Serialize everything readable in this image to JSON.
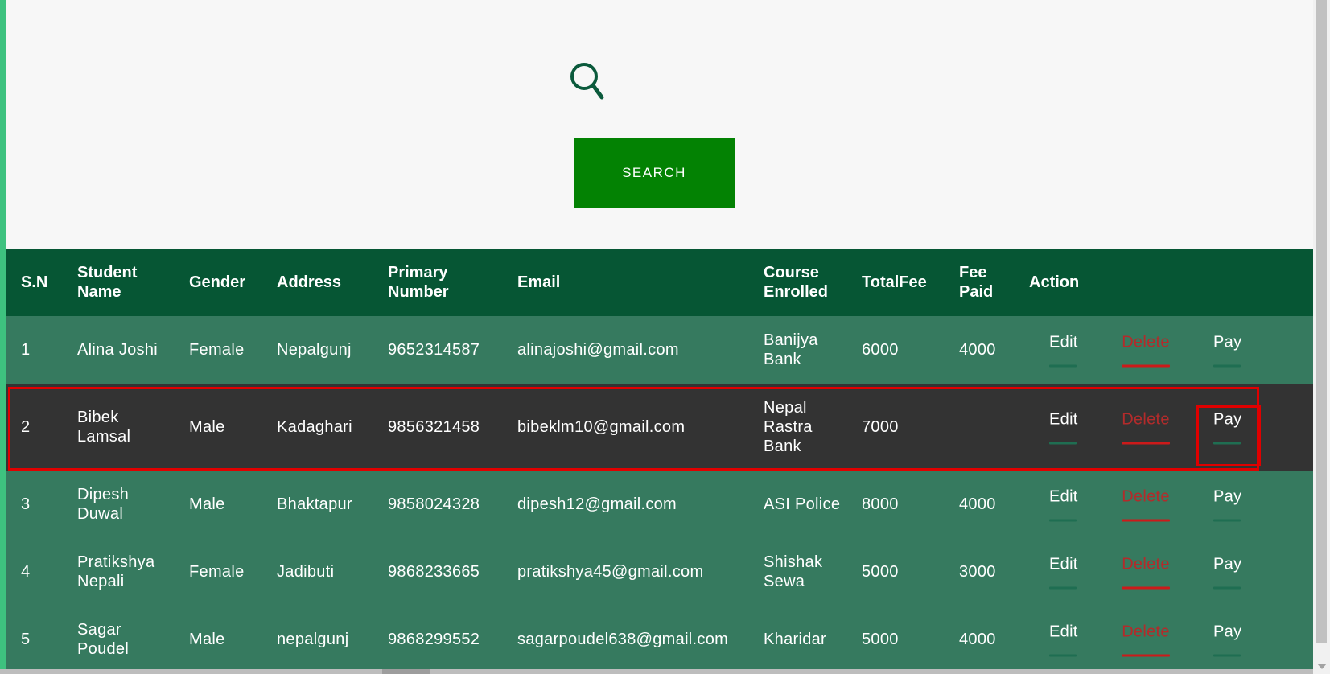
{
  "search": {
    "button_label": "SEARCH"
  },
  "table": {
    "headers": {
      "sn": "S.N",
      "name": "Student Name",
      "gender": "Gender",
      "address": "Address",
      "phone": "Primary Number",
      "email": "Email",
      "course": "Course Enrolled",
      "total": "TotalFee",
      "paid": "Fee Paid",
      "action": "Action"
    },
    "rows": [
      {
        "sn": "1",
        "name": "Alina Joshi",
        "gender": "Female",
        "address": "Nepalgunj",
        "phone": "9652314587",
        "email": "alinajoshi@gmail.com",
        "course": "Banijya Bank",
        "total": "6000",
        "paid": "4000"
      },
      {
        "sn": "2",
        "name": "Bibek Lamsal",
        "gender": "Male",
        "address": "Kadaghari",
        "phone": "9856321458",
        "email": "bibeklm10@gmail.com",
        "course": "Nepal Rastra Bank",
        "total": "7000",
        "paid": ""
      },
      {
        "sn": "3",
        "name": "Dipesh Duwal",
        "gender": "Male",
        "address": "Bhaktapur",
        "phone": "9858024328",
        "email": "dipesh12@gmail.com",
        "course": "ASI Police",
        "total": "8000",
        "paid": "4000"
      },
      {
        "sn": "4",
        "name": "Pratikshya Nepali",
        "gender": "Female",
        "address": "Jadibuti",
        "phone": "9868233665",
        "email": "pratikshya45@gmail.com",
        "course": "Shishak Sewa",
        "total": "5000",
        "paid": "3000"
      },
      {
        "sn": "5",
        "name": "Sagar Poudel",
        "gender": "Male",
        "address": "nepalgunj",
        "phone": "9868299552",
        "email": "sagarpoudel638@gmail.com",
        "course": "Kharidar",
        "total": "5000",
        "paid": "4000"
      }
    ],
    "actions": {
      "edit": "Edit",
      "delete": "Delete",
      "pay": "Pay"
    }
  },
  "colors": {
    "accent_green": "#3ec27f",
    "search_button": "#038203",
    "header_bg": "#065634",
    "row_bg": "#367a5f",
    "highlight_row_bg": "#333333",
    "highlight_border": "#e00000"
  },
  "icons": {
    "search": "search-icon"
  }
}
